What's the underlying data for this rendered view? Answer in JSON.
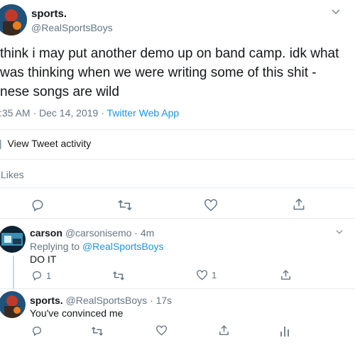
{
  "main_tweet": {
    "display_name": "sports.",
    "handle": "@RealSportsBoys",
    "text_line1": "think i may put another demo up on band camp. idk what",
    "text_line2": "was thinking when we were writing some of this shit -",
    "text_line3": "nese songs are wild",
    "timestamp": ":35 AM · Dec 14, 2019 · ",
    "source": "Twitter Web App",
    "activity_label": "View Tweet activity",
    "likes_label": "Likes"
  },
  "reply1": {
    "display_name": "carson",
    "handle": "@carsonisemo",
    "time": "· 4m",
    "replying_prefix": "Replying to ",
    "replying_to": "@RealSportsBoys",
    "text": "DO IT",
    "reply_count": "1",
    "like_count": "1"
  },
  "reply2": {
    "display_name": "sports.",
    "handle": "@RealSportsBoys",
    "time": "· 17s",
    "text": "You've convinced me"
  },
  "icons": {
    "chevron": "chevron-down-icon",
    "reply": "reply-icon",
    "retweet": "retweet-icon",
    "like": "heart-icon",
    "share": "share-icon",
    "analytics": "analytics-icon"
  },
  "colors": {
    "link": "#1b95e0",
    "muted": "#657786",
    "icon": "#657786",
    "divider": "#e6ecf0"
  }
}
